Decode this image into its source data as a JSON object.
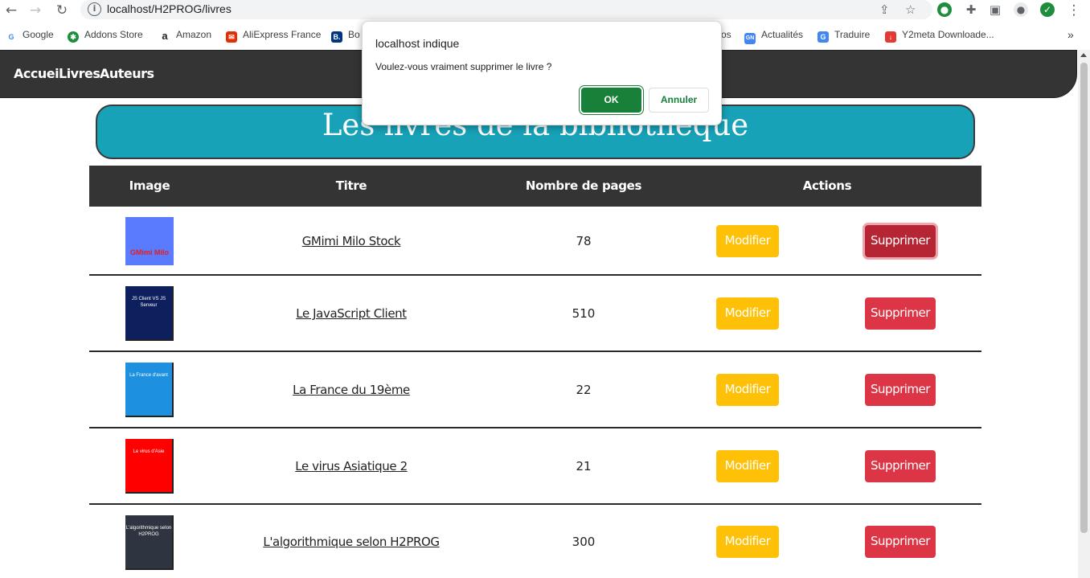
{
  "browser": {
    "url": "localhost/H2PROG/livres",
    "back_glyph": "←",
    "forward_glyph": "→",
    "reload_glyph": "↻",
    "info_glyph": "i",
    "share_glyph": "⇪",
    "star_glyph": "☆",
    "menu_glyph": "⋮",
    "overflow_glyph": "»",
    "bookmarks": [
      {
        "label": "Google",
        "icon": "G",
        "color": "#4285f4"
      },
      {
        "label": "Addons Store",
        "icon": "✱",
        "color": "#1e8e3e"
      },
      {
        "label": "Amazon",
        "icon": "a",
        "color": "#222222"
      },
      {
        "label": "AliExpress France",
        "icon": "✉",
        "color": "#e62e04"
      },
      {
        "label": "Bo",
        "icon": "B.",
        "color": "#003580"
      },
      {
        "label": "os",
        "icon": "",
        "color": "#ffffff"
      },
      {
        "label": "Actualités",
        "icon": "GN",
        "color": "#4285f4"
      },
      {
        "label": "Traduire",
        "icon": "G",
        "color": "#4285f4"
      },
      {
        "label": "Y2meta Downloade...",
        "icon": "↓",
        "color": "#e53935"
      }
    ]
  },
  "nav": {
    "links": [
      "Accueil",
      "Livres",
      "Auteurs"
    ]
  },
  "page": {
    "title": "Les livres de la bibliothèque",
    "headers": [
      "Image",
      "Titre",
      "Nombre de pages",
      "Actions"
    ],
    "books": [
      {
        "title": "GMimi Milo Stock",
        "pages": "78",
        "cover_color": "#5b7bff",
        "cover_text": "GMimi Milo"
      },
      {
        "title": "Le JavaScript Client",
        "pages": "510",
        "cover_color": "#0d1f5c",
        "cover_text": "JS Client VS JS Serveur"
      },
      {
        "title": "La France du 19ème",
        "pages": "22",
        "cover_color": "#1e90e0",
        "cover_text": "La France d'avant"
      },
      {
        "title": "Le virus Asiatique 2",
        "pages": "21",
        "cover_color": "#ff0000",
        "cover_text": "Le virus d'Asie"
      },
      {
        "title": "L'algorithmique selon H2PROG",
        "pages": "300",
        "cover_color": "#2f3540",
        "cover_text": "L'algorithmique selon H2PROG"
      }
    ],
    "modify_label": "Modifier",
    "delete_label": "Supprimer"
  },
  "dialog": {
    "title": "localhost indique",
    "message": "Voulez-vous vraiment supprimer le livre ?",
    "ok_label": "OK",
    "cancel_label": "Annuler"
  },
  "colors": {
    "navbar": "#343434",
    "title_bg": "#17a2b8",
    "modify": "#ffc107",
    "delete": "#dc3545",
    "ok": "#188038"
  }
}
